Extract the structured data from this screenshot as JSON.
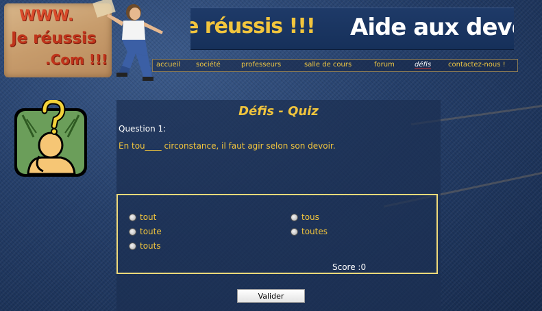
{
  "logo": {
    "line1": "WWW.",
    "line2": "Je réussis",
    "line3": ".Com !!!"
  },
  "banner": {
    "left_text": "e réussis !!!",
    "right_text": "Aide aux devoirs"
  },
  "nav": [
    {
      "label": "accueil"
    },
    {
      "label": "société"
    },
    {
      "label": "professeurs"
    },
    {
      "label": "salle de cours"
    },
    {
      "label": "forum"
    },
    {
      "label": "défis",
      "active": true
    },
    {
      "label": "contactez-nous !"
    }
  ],
  "quiz": {
    "title": "Défis - Quiz",
    "question_label": "Question 1:",
    "question_text": "En tou____ circonstance, il faut agir selon son devoir.",
    "options": [
      "tout",
      "toute",
      "touts",
      "tous",
      "toutes"
    ],
    "score_text": "Score :0",
    "submit_label": "Valider"
  },
  "colors": {
    "accent": "#f2c53d",
    "panel": "#1c2f52",
    "border": "#f0da7a"
  }
}
